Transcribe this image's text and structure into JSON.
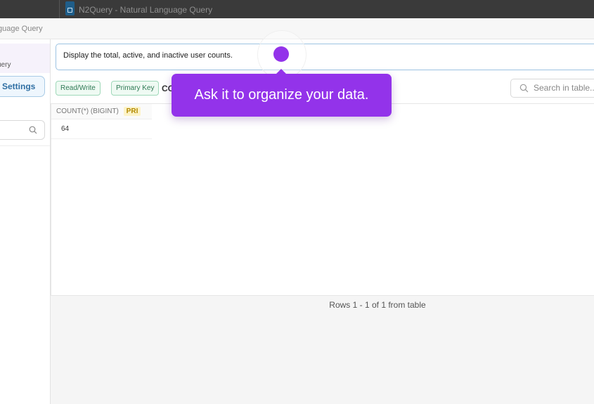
{
  "window": {
    "title": "N2Query - Natural Language Query"
  },
  "header": {
    "breadcrumb": "guage Query"
  },
  "sidebar": {
    "active_item_label": "uery",
    "settings_label": "Settings"
  },
  "query": {
    "text": "Display the total, active, and inactive user counts."
  },
  "toolbar": {
    "tags": [
      "Read/Write",
      "Primary Key"
    ],
    "truncated_label": "CO",
    "search_placeholder": "Search in table..."
  },
  "table": {
    "column": {
      "name": "COUNT(*)",
      "type": "(BIGINT)",
      "badge": "PRI"
    },
    "rows": [
      [
        "64"
      ]
    ]
  },
  "footer": {
    "rows_info": "Rows 1 - 1 of 1 from table"
  },
  "tutorial": {
    "tooltip_text": "Ask it to organize your data."
  },
  "colors": {
    "accent": "#9333ea",
    "tag_green": "#2f7a55",
    "link_blue": "#2f6fa3"
  }
}
